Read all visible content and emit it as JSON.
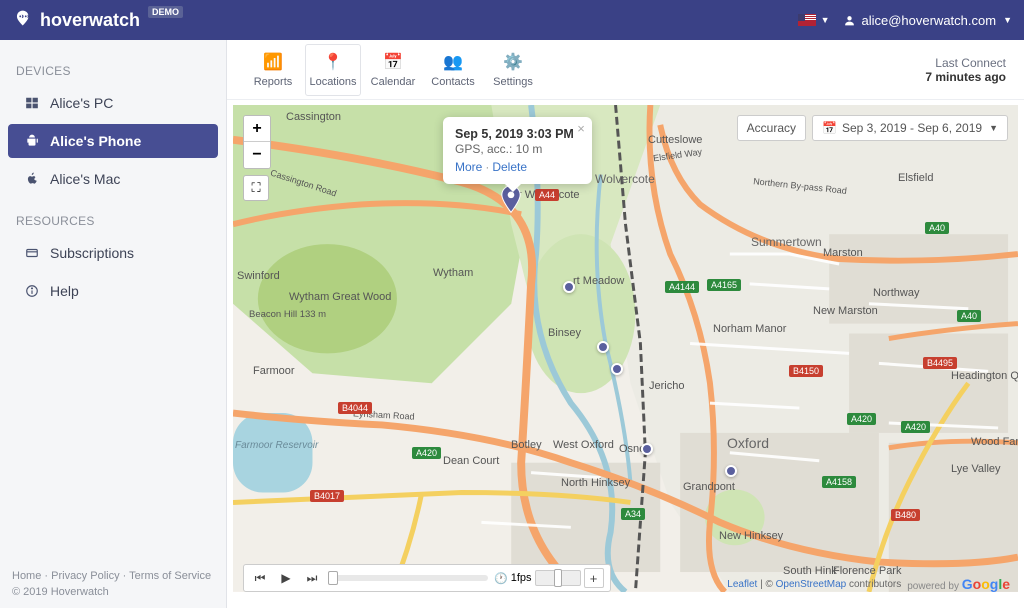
{
  "header": {
    "brand": "hoverwatch",
    "badge": "DEMO",
    "user_email": "alice@hoverwatch.com"
  },
  "sidebar": {
    "section_devices": "DEVICES",
    "section_resources": "RESOURCES",
    "devices": [
      {
        "label": "Alice's PC",
        "icon": "windows"
      },
      {
        "label": "Alice's Phone",
        "icon": "android",
        "active": true
      },
      {
        "label": "Alice's Mac",
        "icon": "apple"
      }
    ],
    "resources": [
      {
        "label": "Subscriptions",
        "icon": "card"
      },
      {
        "label": "Help",
        "icon": "info"
      }
    ],
    "footer_links": {
      "home": "Home",
      "privacy": "Privacy Policy",
      "terms": "Terms of Service"
    },
    "copyright": "© 2019 Hoverwatch"
  },
  "tabs": {
    "reports": "Reports",
    "locations": "Locations",
    "calendar": "Calendar",
    "contacts": "Contacts",
    "settings": "Settings"
  },
  "status": {
    "label": "Last Connect",
    "value": "7 minutes ago"
  },
  "map": {
    "accuracy_label": "Accuracy",
    "date_range": "Sep 3, 2019 - Sep 6, 2019",
    "popup": {
      "title": "Sep 5, 2019 3:03 PM",
      "subtitle": "GPS, acc.: 10 m",
      "more": "More",
      "delete": "Delete"
    },
    "playback": {
      "fps_label": "1fps"
    },
    "attribution": {
      "leaflet": "Leaflet",
      "osm": "OpenStreetMap",
      "contrib": " contributors",
      "powered": "powered by "
    },
    "labels": {
      "cassington": "Cassington",
      "cutteslowe": "Cutteslowe",
      "elsfield": "Elsfield",
      "wolvercote": "Wolvercote",
      "lower_wolvercote": "r Wolvercote",
      "summertown": "Summertown",
      "marston": "Marston",
      "new_marston": "New Marston",
      "northway": "Northway",
      "wytham": "Wytham",
      "wytham_wood": "Wytham Great Wood",
      "swinford": "Swinford",
      "beacon_hill": "Beacon Hill 133 m",
      "binsey": "Binsey",
      "norham": "Norham Manor",
      "jericho": "Jericho",
      "farmoor": "Farmoor",
      "reservoir": "Farmoor Reservoir",
      "botley": "Botley",
      "west_oxford": "West Oxford",
      "osney": "Osney",
      "oxford": "Oxford",
      "dean_court": "Dean Court",
      "north_hinksey": "North Hinksey",
      "grandpont": "Grandpont",
      "new_hinksey": "New Hinksey",
      "south_hinksey": "South Hink",
      "lye_valley": "Lye Valley",
      "wood_farm": "Wood Farm",
      "headington_quarry": "Headington Quarry",
      "meadow": "rt Meadow",
      "florence": "Florence Park",
      "elsfield_way": "Elsfield Way",
      "bypass": "Northern By-pass Road",
      "eynsham_rd": "Eynsham Road",
      "cassington_rd": "Cassington Road"
    },
    "roads": {
      "a40_1": "A40",
      "a40_2": "A40",
      "a44": "A44",
      "a4144": "A4144",
      "a4165": "A4165",
      "a420_1": "A420",
      "a420_2": "A420",
      "a420_3": "A420",
      "a34": "A34",
      "a4158": "A4158",
      "b4044": "B4044",
      "b4017": "B4017",
      "b4150": "B4150",
      "b4495": "B4495",
      "b480": "B480"
    }
  }
}
